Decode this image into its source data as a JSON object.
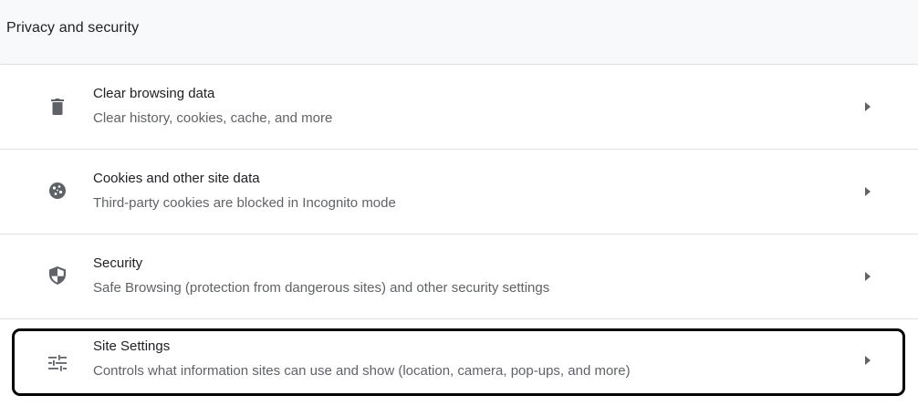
{
  "section": {
    "title": "Privacy and security"
  },
  "rows": [
    {
      "icon": "trash-icon",
      "label": "Clear browsing data",
      "sublabel": "Clear history, cookies, cache, and more"
    },
    {
      "icon": "cookie-icon",
      "label": "Cookies and other site data",
      "sublabel": "Third-party cookies are blocked in Incognito mode"
    },
    {
      "icon": "shield-icon",
      "label": "Security",
      "sublabel": "Safe Browsing (protection from dangerous sites) and other security settings"
    },
    {
      "icon": "tune-icon",
      "label": "Site Settings",
      "sublabel": "Controls what information sites can use and show (location, camera, pop-ups, and more)"
    }
  ],
  "colors": {
    "text_primary": "#202124",
    "text_secondary": "#5f6368",
    "icon": "#5f6368",
    "background": "#f8f9fa",
    "card": "#ffffff",
    "highlight": "#000000"
  }
}
